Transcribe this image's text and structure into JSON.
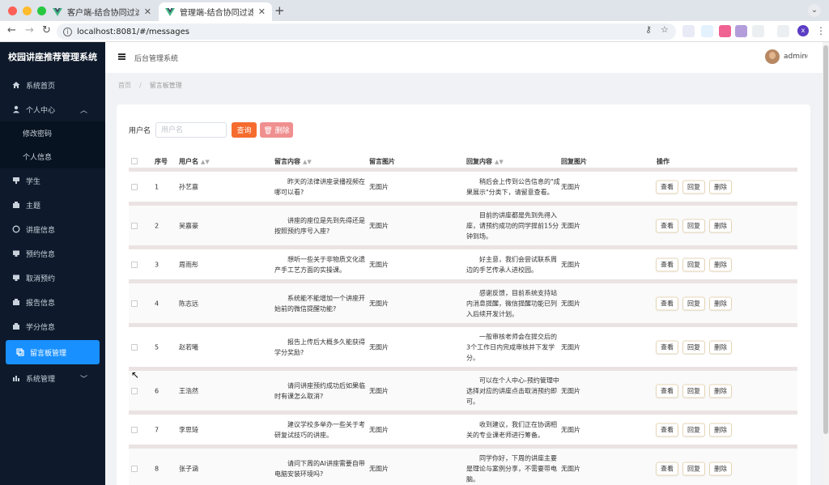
{
  "browser": {
    "tabs": [
      {
        "title": "客户端-结合协同过滤的校园讲座"
      },
      {
        "title": "管理端-结合协同过滤的校园讲座"
      }
    ],
    "url": "localhost:8081/#/messages",
    "profile_initial": "x"
  },
  "sidebar": {
    "title": "校园讲座推荐管理系统",
    "items": [
      {
        "label": "系统首页",
        "icon": "home-icon"
      },
      {
        "label": "个人中心",
        "icon": "user-icon",
        "expanded": true,
        "children": [
          {
            "label": "修改密码"
          },
          {
            "label": "个人信息"
          }
        ]
      },
      {
        "label": "学生",
        "icon": "student-icon"
      },
      {
        "label": "主题",
        "icon": "topic-icon"
      },
      {
        "label": "讲座信息",
        "icon": "lecture-icon"
      },
      {
        "label": "预约信息",
        "icon": "booking-icon"
      },
      {
        "label": "取消预约",
        "icon": "cancel-booking-icon"
      },
      {
        "label": "报告信息",
        "icon": "report-icon"
      },
      {
        "label": "学分信息",
        "icon": "credit-icon"
      },
      {
        "label": "留言板管理",
        "icon": "message-board-icon",
        "active": true
      },
      {
        "label": "系统管理",
        "icon": "system-icon"
      }
    ]
  },
  "header": {
    "title": "后台管理系统",
    "user": "admin"
  },
  "breadcrumb": {
    "home": "首页",
    "current": "留言板管理"
  },
  "search": {
    "label": "用户名",
    "placeholder": "用户名",
    "query_label": "查询",
    "delete_label": "删除"
  },
  "table": {
    "headers": {
      "index": "序号",
      "username": "用户名",
      "content": "留言内容",
      "image": "留言图片",
      "reply": "回复内容",
      "reply_image": "回复图片",
      "actions": "操作"
    },
    "action_labels": {
      "view": "查看",
      "reply": "回复",
      "delete": "删除"
    },
    "rows": [
      {
        "index": "1",
        "username": "孙艺嘉",
        "content": "昨天的法律讲座录播视频在哪可以看?",
        "image": "无图片",
        "reply": "稍后会上传到公告信息的\"成果展示\"分类下，请留意查看。",
        "reply_image": "无图片"
      },
      {
        "index": "2",
        "username": "吴嘉豪",
        "content": "讲座的座位是先到先得还是按照预约序号入座?",
        "image": "无图片",
        "reply": "目前的讲座都是先到先得入座，请预约成功的同学提前15分钟到场。",
        "reply_image": "无图片"
      },
      {
        "index": "3",
        "username": "周雨彤",
        "content": "想听一些关于非物质文化遗产手工艺方面的实操课。",
        "image": "无图片",
        "reply": "好主意，我们会尝试联系周边的手艺传承人进校园。",
        "reply_image": "无图片"
      },
      {
        "index": "4",
        "username": "陈志远",
        "content": "系统能不能增加一个讲座开始前的微信提醒功能?",
        "image": "无图片",
        "reply": "感谢反馈，目前系统支持站内消息提醒，微信提醒功能已列入后续开发计划。",
        "reply_image": "无图片"
      },
      {
        "index": "5",
        "username": "赵若曦",
        "content": "报告上传后大概多久能获得学分奖励?",
        "image": "无图片",
        "reply": "一般审核老师会在提交后的3个工作日内完成审核并下发学分。",
        "reply_image": "无图片"
      },
      {
        "index": "6",
        "username": "王浩然",
        "content": "请问讲座预约成功后如果临时有课怎么取消?",
        "image": "无图片",
        "reply": "可以在个人中心-预约管理中选择对应的讲座点击取消预约即可。",
        "reply_image": "无图片"
      },
      {
        "index": "7",
        "username": "李思琦",
        "content": "建议学校多举办一些关于考研复试技巧的讲座。",
        "image": "无图片",
        "reply": "收到建议，我们正在协调相关的专业课老师进行筹备。",
        "reply_image": "无图片"
      },
      {
        "index": "8",
        "username": "张子涵",
        "content": "请问下周的AI讲座需要自带电脑安装环境吗?",
        "image": "无图片",
        "reply": "同学你好，下周的讲座主要是理论与案例分享，不需要带电脑。",
        "reply_image": "无图片"
      }
    ]
  },
  "colors": {
    "sidebar_bg": "#0e1a2b",
    "active_item": "#1890ff",
    "query_button": "#f56c2e",
    "delete_button": "#f08f8f"
  }
}
